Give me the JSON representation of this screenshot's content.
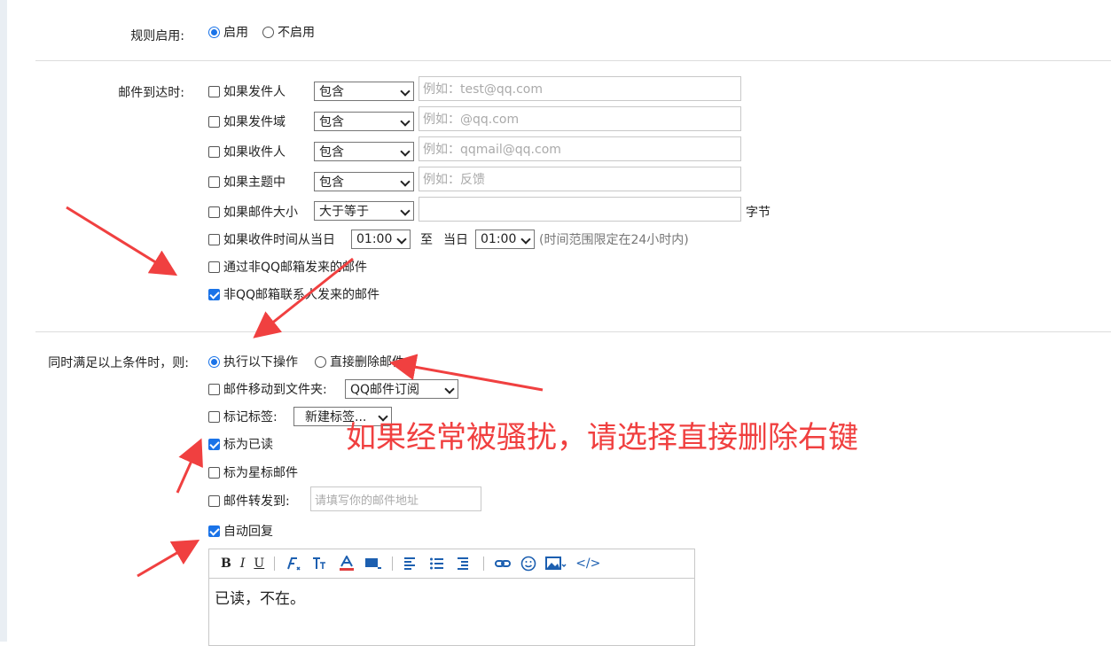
{
  "rule_enable": {
    "label": "规则启用:",
    "options": [
      "启用",
      "不启用"
    ],
    "selected": "启用"
  },
  "conditions": {
    "label": "邮件到达时:",
    "sender": {
      "label": "如果发件人",
      "op": "包含",
      "placeholder": "例如：test@qq.com",
      "checked": false
    },
    "sender_domain": {
      "label": "如果发件域",
      "op": "包含",
      "placeholder": "例如：@qq.com",
      "checked": false
    },
    "recipient": {
      "label": "如果收件人",
      "op": "包含",
      "placeholder": "例如：qqmail@qq.com",
      "checked": false
    },
    "subject": {
      "label": "如果主题中",
      "op": "包含",
      "placeholder": "例如：反馈",
      "checked": false
    },
    "size": {
      "label": "如果邮件大小",
      "op": "大于等于",
      "value": "",
      "unit": "字节",
      "checked": false
    },
    "time": {
      "label": "如果收件时间从当日",
      "from": "01:00",
      "to_label": "至",
      "day_label": "当日",
      "to": "01:00",
      "hint": "(时间范围限定在24小时内)",
      "checked": false
    },
    "non_qq": {
      "label": "通过非QQ邮箱发来的邮件",
      "checked": false
    },
    "non_contact": {
      "label": "非QQ邮箱联系人发来的邮件",
      "checked": true
    }
  },
  "actions": {
    "label": "同时满足以上条件时，则:",
    "mode_options": [
      "执行以下操作",
      "直接删除邮件"
    ],
    "mode_selected": "执行以下操作",
    "move": {
      "label": "邮件移动到文件夹:",
      "value": "QQ邮件订阅",
      "checked": false
    },
    "tag": {
      "label": "标记标签:",
      "value": "新建标签...",
      "checked": false
    },
    "mark_read": {
      "label": "标为已读",
      "checked": true
    },
    "star": {
      "label": "标为星标邮件",
      "checked": false
    },
    "forward": {
      "label": "邮件转发到:",
      "placeholder": "请填写你的邮件地址",
      "checked": false
    },
    "auto_reply": {
      "label": "自动回复",
      "checked": true
    }
  },
  "editor": {
    "toolbar": [
      "B",
      "I",
      "U",
      "font-icon",
      "font-size-icon",
      "font-color-icon",
      "highlight-icon",
      "align-icon",
      "list-icon",
      "indent-icon",
      "link-icon",
      "emoji-icon",
      "image-icon",
      "</>"
    ],
    "content": "已读，不在。"
  },
  "annotation": {
    "text": "如果经常被骚扰，请选择直接删除右键",
    "color": "#f04040"
  },
  "colors": {
    "accent": "#1a73e8",
    "annotation": "#f04040"
  }
}
